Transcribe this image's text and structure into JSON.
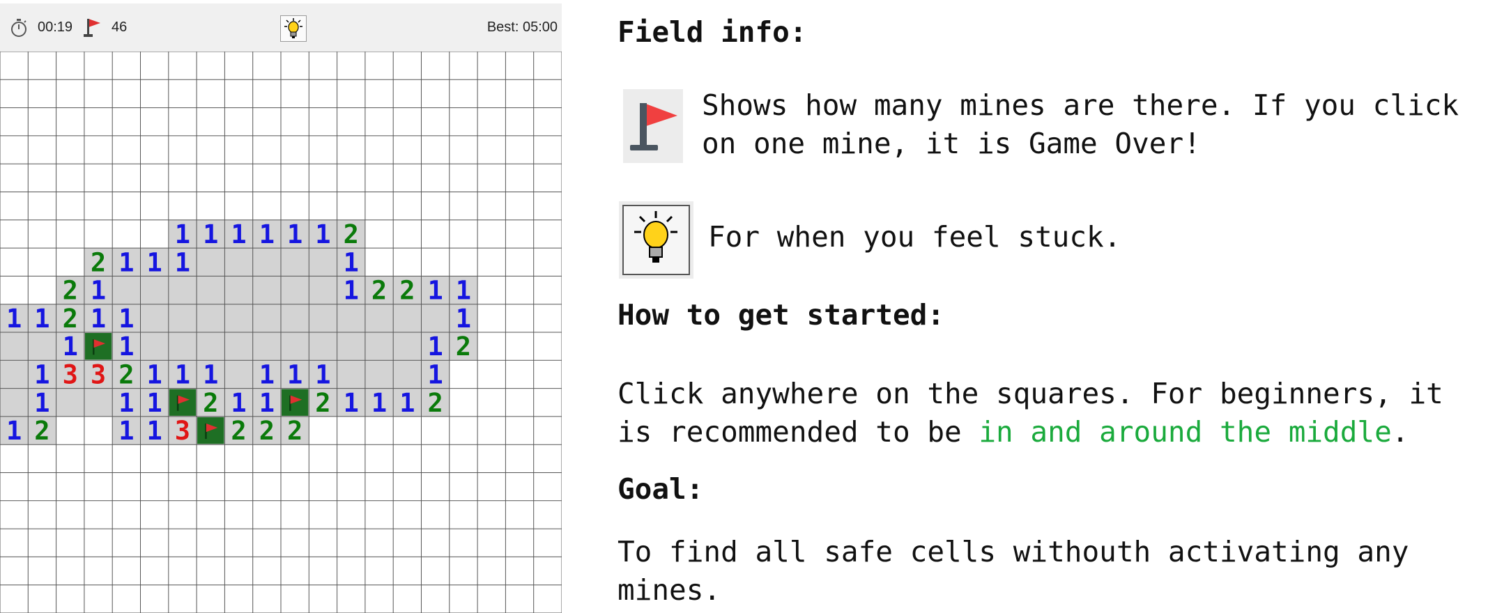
{
  "topbar": {
    "timer_icon": "stopwatch-icon",
    "timer": "00:19",
    "flag_icon": "flag-icon",
    "flags": "46",
    "hint_icon": "lightbulb-icon",
    "best": "Best: 05:00"
  },
  "board": {
    "cols": 20,
    "rows": 20,
    "colors": {
      "grid_line": "#555555",
      "revealed": "#d3d3d3",
      "one": "#1515e0",
      "two": "#0a7a0a",
      "three": "#e01515",
      "flag_cell": "#1e6f24",
      "flag": "#e03030"
    },
    "revealed_cells": [
      [
        6,
        6
      ],
      [
        6,
        7
      ],
      [
        6,
        8
      ],
      [
        6,
        9
      ],
      [
        6,
        10
      ],
      [
        6,
        11
      ],
      [
        6,
        12
      ],
      [
        7,
        3
      ],
      [
        7,
        4
      ],
      [
        7,
        5
      ],
      [
        7,
        6
      ],
      [
        7,
        7
      ],
      [
        7,
        8
      ],
      [
        7,
        9
      ],
      [
        7,
        10
      ],
      [
        7,
        11
      ],
      [
        7,
        12
      ],
      [
        8,
        2
      ],
      [
        8,
        3
      ],
      [
        8,
        4
      ],
      [
        8,
        5
      ],
      [
        8,
        6
      ],
      [
        8,
        7
      ],
      [
        8,
        8
      ],
      [
        8,
        9
      ],
      [
        8,
        10
      ],
      [
        8,
        11
      ],
      [
        8,
        12
      ],
      [
        8,
        13
      ],
      [
        8,
        14
      ],
      [
        8,
        15
      ],
      [
        8,
        16
      ],
      [
        9,
        0
      ],
      [
        9,
        1
      ],
      [
        9,
        2
      ],
      [
        9,
        3
      ],
      [
        9,
        4
      ],
      [
        9,
        5
      ],
      [
        9,
        6
      ],
      [
        9,
        7
      ],
      [
        9,
        8
      ],
      [
        9,
        9
      ],
      [
        9,
        10
      ],
      [
        9,
        11
      ],
      [
        9,
        12
      ],
      [
        9,
        13
      ],
      [
        9,
        14
      ],
      [
        9,
        15
      ],
      [
        9,
        16
      ],
      [
        10,
        0
      ],
      [
        10,
        1
      ],
      [
        10,
        2
      ],
      [
        10,
        3
      ],
      [
        10,
        4
      ],
      [
        10,
        5
      ],
      [
        10,
        6
      ],
      [
        10,
        7
      ],
      [
        10,
        8
      ],
      [
        10,
        9
      ],
      [
        10,
        10
      ],
      [
        10,
        11
      ],
      [
        10,
        12
      ],
      [
        10,
        13
      ],
      [
        10,
        14
      ],
      [
        10,
        15
      ],
      [
        10,
        16
      ],
      [
        11,
        0
      ],
      [
        11,
        1
      ],
      [
        11,
        2
      ],
      [
        11,
        3
      ],
      [
        11,
        4
      ],
      [
        11,
        5
      ],
      [
        11,
        6
      ],
      [
        11,
        7
      ],
      [
        11,
        8
      ],
      [
        11,
        9
      ],
      [
        11,
        10
      ],
      [
        11,
        11
      ],
      [
        11,
        12
      ],
      [
        11,
        13
      ],
      [
        11,
        14
      ],
      [
        11,
        15
      ],
      [
        12,
        0
      ],
      [
        12,
        1
      ],
      [
        12,
        2
      ],
      [
        12,
        3
      ],
      [
        12,
        4
      ],
      [
        12,
        5
      ],
      [
        12,
        6
      ],
      [
        12,
        7
      ],
      [
        12,
        8
      ],
      [
        12,
        9
      ],
      [
        12,
        10
      ],
      [
        12,
        11
      ],
      [
        12,
        12
      ],
      [
        12,
        13
      ],
      [
        12,
        14
      ],
      [
        12,
        15
      ],
      [
        13,
        0
      ],
      [
        13,
        1
      ],
      [
        13,
        4
      ],
      [
        13,
        5
      ],
      [
        13,
        6
      ],
      [
        13,
        7
      ],
      [
        13,
        8
      ],
      [
        13,
        9
      ],
      [
        13,
        10
      ]
    ],
    "numbers": [
      [
        6,
        6,
        "1"
      ],
      [
        6,
        7,
        "1"
      ],
      [
        6,
        8,
        "1"
      ],
      [
        6,
        9,
        "1"
      ],
      [
        6,
        10,
        "1"
      ],
      [
        6,
        11,
        "1"
      ],
      [
        6,
        12,
        "2"
      ],
      [
        7,
        3,
        "2"
      ],
      [
        7,
        4,
        "1"
      ],
      [
        7,
        5,
        "1"
      ],
      [
        7,
        6,
        "1"
      ],
      [
        7,
        12,
        "1"
      ],
      [
        8,
        2,
        "2"
      ],
      [
        8,
        3,
        "1"
      ],
      [
        8,
        12,
        "1"
      ],
      [
        8,
        13,
        "2"
      ],
      [
        8,
        14,
        "2"
      ],
      [
        8,
        15,
        "1"
      ],
      [
        8,
        16,
        "1"
      ],
      [
        9,
        0,
        "1"
      ],
      [
        9,
        1,
        "1"
      ],
      [
        9,
        2,
        "2"
      ],
      [
        9,
        3,
        "1"
      ],
      [
        9,
        4,
        "1"
      ],
      [
        9,
        16,
        "1"
      ],
      [
        10,
        2,
        "1"
      ],
      [
        10,
        4,
        "1"
      ],
      [
        10,
        15,
        "1"
      ],
      [
        10,
        16,
        "2"
      ],
      [
        11,
        1,
        "1"
      ],
      [
        11,
        2,
        "3"
      ],
      [
        11,
        3,
        "3"
      ],
      [
        11,
        4,
        "2"
      ],
      [
        11,
        5,
        "1"
      ],
      [
        11,
        6,
        "1"
      ],
      [
        11,
        7,
        "1"
      ],
      [
        11,
        9,
        "1"
      ],
      [
        11,
        10,
        "1"
      ],
      [
        11,
        11,
        "1"
      ],
      [
        11,
        15,
        "1"
      ],
      [
        12,
        1,
        "1"
      ],
      [
        12,
        4,
        "1"
      ],
      [
        12,
        5,
        "1"
      ],
      [
        12,
        7,
        "2"
      ],
      [
        12,
        8,
        "1"
      ],
      [
        12,
        9,
        "1"
      ],
      [
        12,
        11,
        "2"
      ],
      [
        12,
        12,
        "1"
      ],
      [
        12,
        13,
        "1"
      ],
      [
        12,
        14,
        "1"
      ],
      [
        12,
        15,
        "2"
      ],
      [
        13,
        0,
        "1"
      ],
      [
        13,
        1,
        "2"
      ],
      [
        13,
        4,
        "1"
      ],
      [
        13,
        5,
        "1"
      ],
      [
        13,
        6,
        "3"
      ],
      [
        13,
        8,
        "2"
      ],
      [
        13,
        9,
        "2"
      ],
      [
        13,
        10,
        "2"
      ]
    ],
    "flags": [
      [
        10,
        3
      ],
      [
        12,
        6
      ],
      [
        12,
        10
      ],
      [
        13,
        7
      ]
    ]
  },
  "info": {
    "field_info_title": "Field info:",
    "flag_line1": "Shows how many mines are there. If you click",
    "flag_line2": "on one mine, it is Game Over!",
    "hint_text": "For when you feel stuck.",
    "started_title": "How to get started:",
    "started_line1": "Click anywhere on the squares. For beginners, it",
    "started_line2_a": "is recommended to be ",
    "started_line2_b": "in and around the middle",
    "started_line2_c": ".",
    "goal_title": "Goal:",
    "goal_line1": "To find all safe cells withouth activating any",
    "goal_line2": "mines.",
    "highlight_color": "#1aaa3c"
  }
}
